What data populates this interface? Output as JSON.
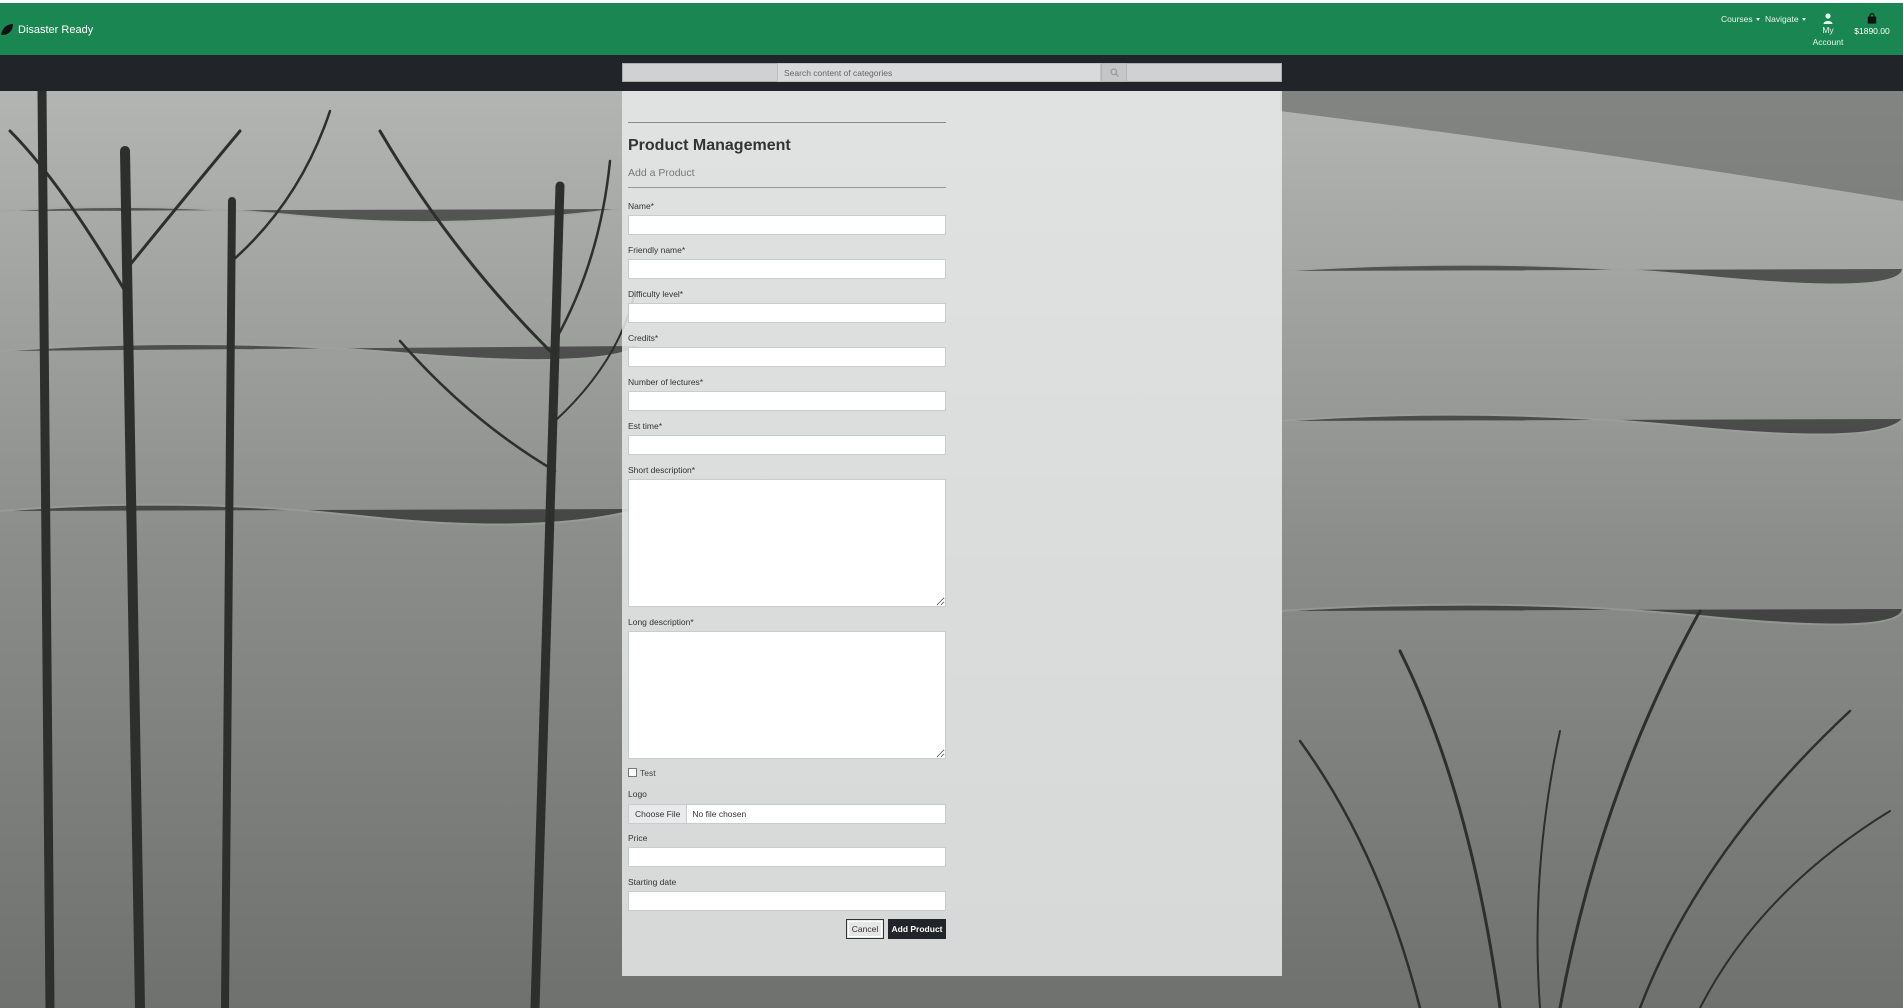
{
  "navbar": {
    "brand": "Disaster Ready",
    "courses_label": "Courses",
    "navigate_label": "Navigate",
    "account_line1": "My",
    "account_line2": "Account",
    "cart_total": "$1890.00"
  },
  "search": {
    "placeholder": "Search content of categories"
  },
  "form": {
    "title": "Product Management",
    "subtitle": "Add a Product",
    "fields": {
      "name": "Name*",
      "friendly_name": "Friendly name*",
      "difficulty": "Difficulty level*",
      "credits": "Credits*",
      "lectures": "Number of lectures*",
      "est_time": "Est time*",
      "short_description": "Short description*",
      "long_description": "Long description*",
      "test": "Test",
      "logo": "Logo",
      "price": "Price",
      "starting_date": "Starting date"
    },
    "file_button": "Choose File",
    "file_status": "No file chosen",
    "cancel_label": "Cancel",
    "submit_label": "Add Product"
  },
  "colors": {
    "navbar": "#1a8752",
    "searchband": "#212529",
    "submit_button": "#212529"
  },
  "icons": {
    "brand": "leaf-icon",
    "account": "user-icon",
    "cart": "shopping-bag-icon",
    "search": "search-icon"
  }
}
